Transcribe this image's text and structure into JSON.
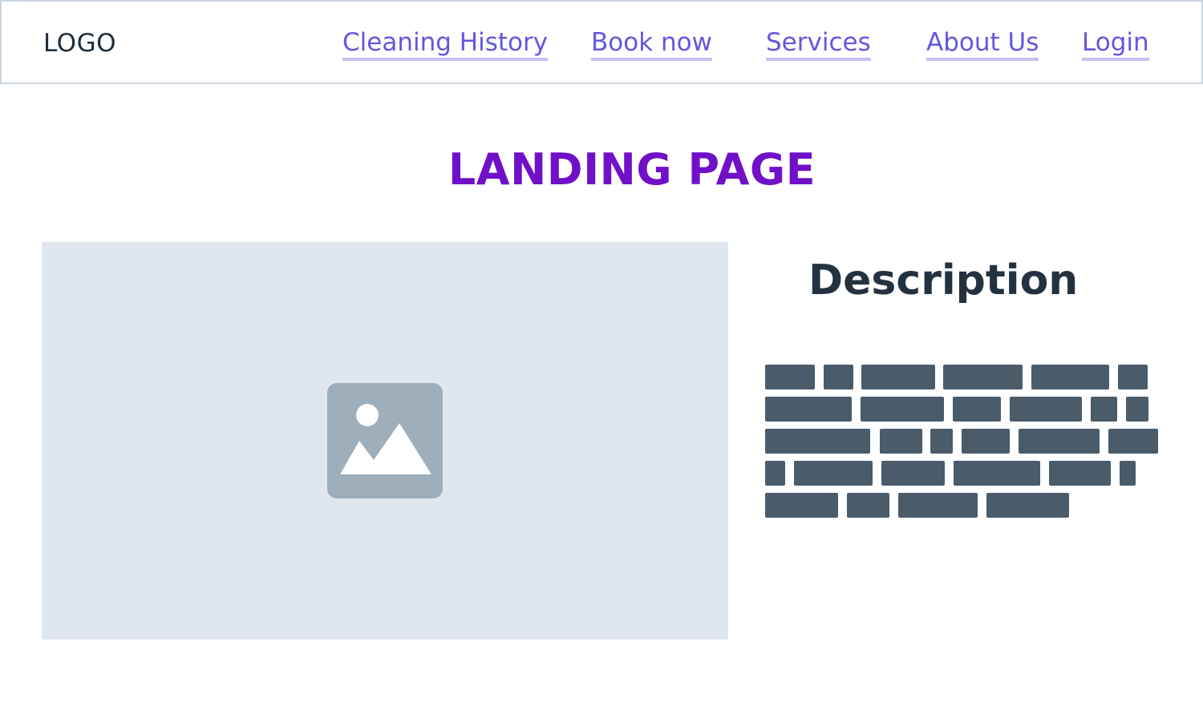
{
  "header": {
    "logo": "LOGO",
    "nav": [
      {
        "label": "Cleaning History"
      },
      {
        "label": "Book now"
      },
      {
        "label": "Services"
      },
      {
        "label": "About Us"
      },
      {
        "label": "Login"
      }
    ]
  },
  "main": {
    "title": "LANDING PAGE",
    "image_icon": "image-placeholder-icon",
    "description": {
      "title": "Description"
    }
  },
  "colors": {
    "link": "#6456e0",
    "title": "#7010c8",
    "text_block": "#4a5b6a",
    "image_bg": "#dfe6ee"
  }
}
